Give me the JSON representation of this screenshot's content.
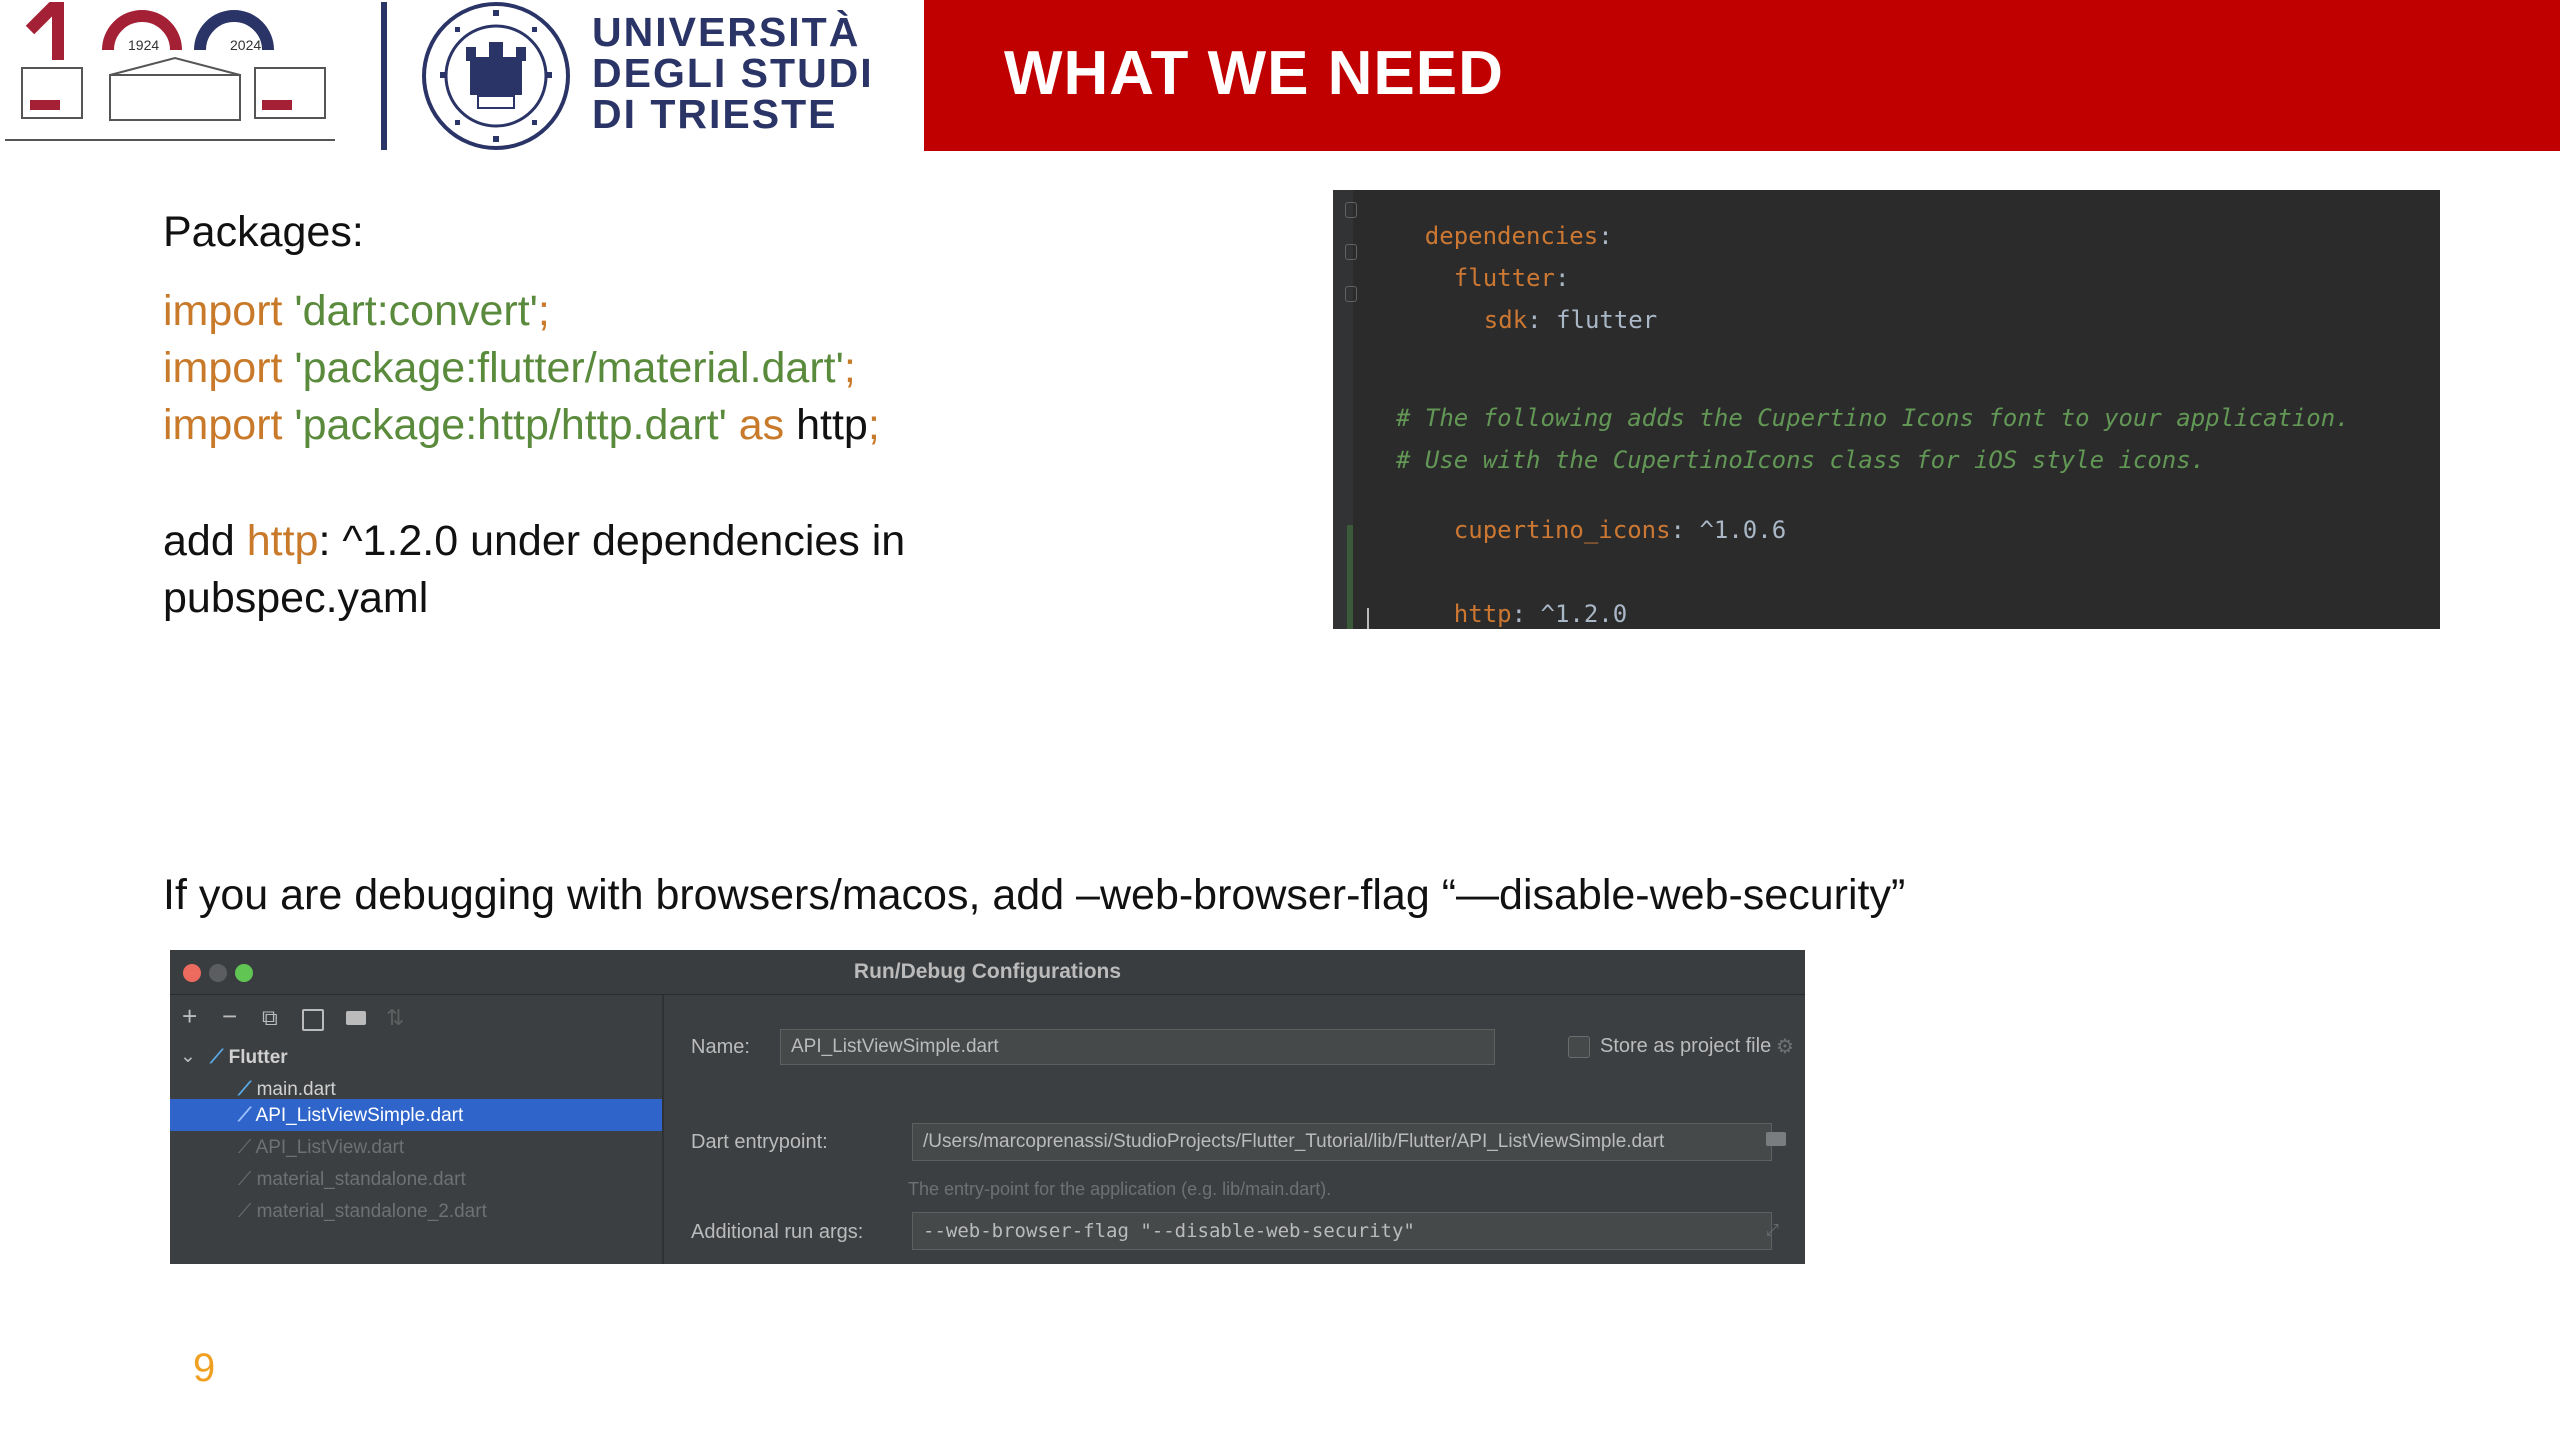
{
  "header": {
    "title": "WHAT WE NEED",
    "logo_years": [
      "1924",
      "2024"
    ],
    "university_name": [
      "UNIVERSITÀ",
      "DEGLI STUDI",
      "DI TRIESTE"
    ],
    "seal_text": "UNIVERSITAS STUDIORUM PERGES TVD MCMXXIV",
    "brand_color": "#c00000"
  },
  "content": {
    "packages_heading": "Packages:",
    "imports": [
      {
        "kw": "import",
        "str": "'dart:convert'",
        "suffix": ";"
      },
      {
        "kw": "import",
        "str": "'package:flutter/material.dart'",
        "suffix": ";"
      },
      {
        "kw": "import",
        "str": "'package:http/http.dart'",
        "as": "as",
        "alias": "http",
        "suffix": ";"
      }
    ],
    "add_line": {
      "prefix": "add ",
      "pkg": "http",
      "rest": ": ^1.2.0 under dependencies in",
      "line2": "pubspec.yaml"
    },
    "debug_note": "If you are debugging with browsers/macos, add –web-browser-flag “—disable-web-security”",
    "page_number": "9"
  },
  "yaml": {
    "dependencies": "dependencies",
    "flutter_key": "flutter",
    "sdk_key": "sdk",
    "sdk_val": "flutter",
    "comment1": "# The following adds the Cupertino Icons font to your application.",
    "comment2": "# Use with the CupertinoIcons class for iOS style icons.",
    "cupertino_key": "cupertino_icons",
    "cupertino_val": "^1.0.6",
    "http_key": "http",
    "http_val": "^1.2.0"
  },
  "dialog": {
    "title": "Run/Debug Configurations",
    "toolbar": [
      "+",
      "−",
      "⧉",
      "💾",
      "📁",
      "⇅"
    ],
    "tree": {
      "root": "Flutter",
      "items": [
        {
          "label": "main.dart",
          "state": "normal"
        },
        {
          "label": "API_ListViewSimple.dart",
          "state": "selected"
        },
        {
          "label": "API_ListView.dart",
          "state": "dim"
        },
        {
          "label": "material_standalone.dart",
          "state": "dim"
        },
        {
          "label": "material_standalone_2.dart",
          "state": "dim"
        }
      ]
    },
    "name_label": "Name:",
    "name_value": "API_ListViewSimple.dart",
    "store_label": "Store as project file",
    "entry_label": "Dart entrypoint:",
    "entry_value": "/Users/marcoprenassi/StudioProjects/Flutter_Tutorial/lib/Flutter/API_ListViewSimple.dart",
    "entry_hint": "The entry-point for the application (e.g. lib/main.dart).",
    "args_label": "Additional run args:",
    "args_value": "--web-browser-flag \"--disable-web-security\""
  }
}
